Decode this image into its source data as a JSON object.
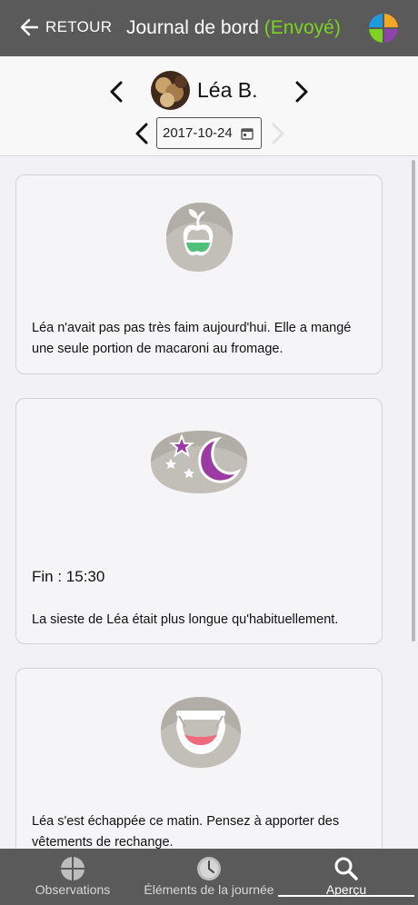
{
  "header": {
    "back_label": "RETOUR",
    "title": "Journal de bord",
    "status": "(Envoyé)",
    "status_color": "#7ed321",
    "background": "#5a5a5a"
  },
  "child": {
    "name": "Léa B.",
    "date": "2017-10-24"
  },
  "cards": [
    {
      "icon": "apple-meal-icon",
      "text": "Léa n'avait pas pas très faim aujourd'hui. Elle a mangé une seule portion de macaroni au fromage."
    },
    {
      "icon": "moon-stars-nap-icon",
      "time": "Fin : 15:30",
      "text": "La sieste de Léa était plus longue qu'habituellement."
    },
    {
      "icon": "diaper-icon",
      "text": "Léa s'est échappée ce matin. Pensez à apporter des vêtements de rechange."
    }
  ],
  "tabs": [
    {
      "label": "Observations",
      "icon": "crosshair-circle-icon",
      "active": false
    },
    {
      "label": "Éléments de la journée",
      "icon": "clock-icon",
      "active": false
    },
    {
      "label": "Aperçu",
      "icon": "search-icon",
      "active": true
    }
  ]
}
